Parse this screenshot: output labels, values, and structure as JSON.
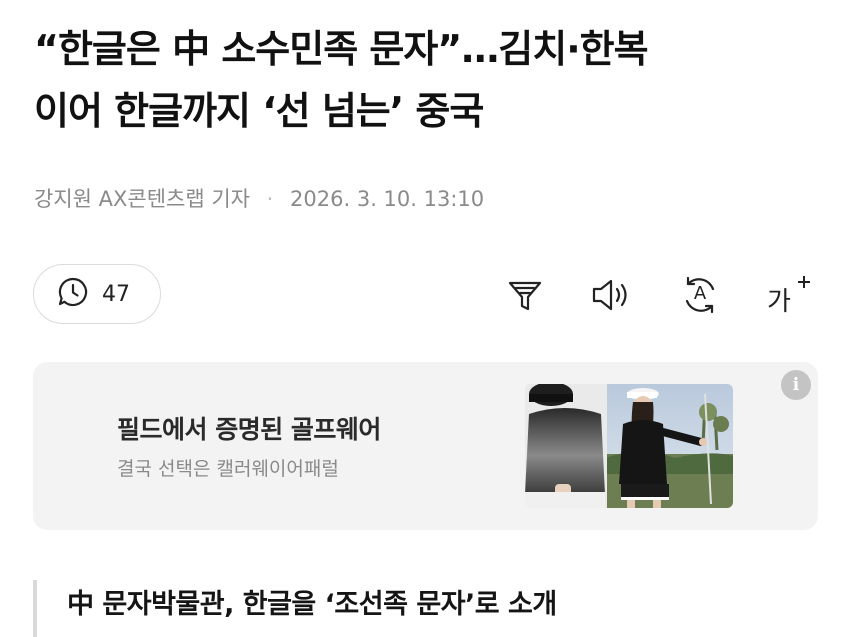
{
  "article": {
    "headline_line1": "“한글은 中 소수민족 문자”…김치·한복",
    "headline_line2": "이어 한글까지 ‘선 넘는’ 중국",
    "reporter": "강지원 AX콘텐츠랩 기자",
    "separator": "·",
    "datetime": "2026. 3. 10. 13:10",
    "subheading": "中 문자박물관, 한글을 ‘조선족 문자’로 소개"
  },
  "toolbar": {
    "comment_count": "47",
    "tools": [
      "filter-icon",
      "speaker-icon",
      "translate-icon",
      "font-size-icon"
    ],
    "font_size_glyph": "가",
    "translate_glyph": "A"
  },
  "ad": {
    "title": "필드에서 증명된 골프웨어",
    "subtitle": "결국 선택은 캘러웨이어패럴",
    "info_glyph": "i"
  },
  "colors": {
    "headline": "#111111",
    "meta": "#8a8a8a",
    "ad_background": "#f3f3f3",
    "border": "#dcdcdc"
  }
}
